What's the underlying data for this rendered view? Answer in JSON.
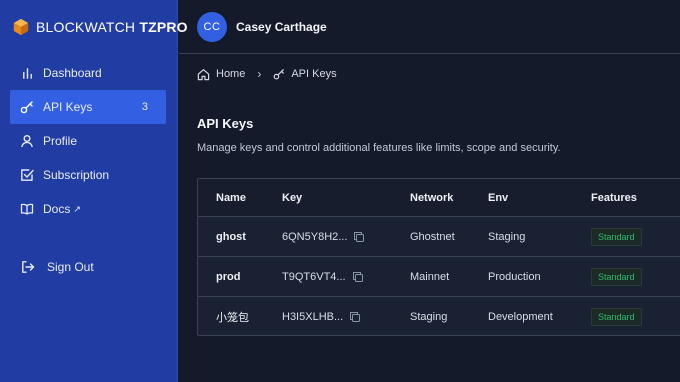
{
  "brand": {
    "name_thin": "BLOCKWATCH",
    "name_bold": "TZPRO"
  },
  "sidebar": {
    "items": [
      {
        "label": "Dashboard",
        "icon": "bar-chart-icon"
      },
      {
        "label": "API Keys",
        "icon": "key-icon",
        "badge": "3",
        "active": true
      },
      {
        "label": "Profile",
        "icon": "user-icon"
      },
      {
        "label": "Subscription",
        "icon": "checkbox-icon"
      },
      {
        "label": "Docs",
        "icon": "book-icon",
        "ext": "↗"
      },
      {
        "label": "Sign Out",
        "icon": "sign-out-icon"
      }
    ]
  },
  "user": {
    "initials": "CC",
    "name": "Casey Carthage"
  },
  "breadcrumb": {
    "home": "Home",
    "current": "API Keys"
  },
  "page": {
    "title": "API Keys",
    "subtitle": "Manage keys and control additional features like limits, scope and security."
  },
  "table": {
    "headers": [
      "Name",
      "Key",
      "Network",
      "Env",
      "Features"
    ],
    "rows": [
      {
        "name": "ghost",
        "key": "6QN5Y8H2...",
        "network": "Ghostnet",
        "env": "Staging",
        "feature": "Standard"
      },
      {
        "name": "prod",
        "key": "T9QT6VT4...",
        "network": "Mainnet",
        "env": "Production",
        "feature": "Standard"
      },
      {
        "name": "小笼包",
        "key": "H3I5XLHB...",
        "network": "Staging",
        "env": "Development",
        "feature": "Standard"
      }
    ]
  },
  "colors": {
    "sidebar_bg": "#213da3",
    "active_bg": "#3360e3",
    "page_bg": "#141a29",
    "feature_green": "#2bbd6e",
    "logo_orange": "#f39c2a"
  }
}
